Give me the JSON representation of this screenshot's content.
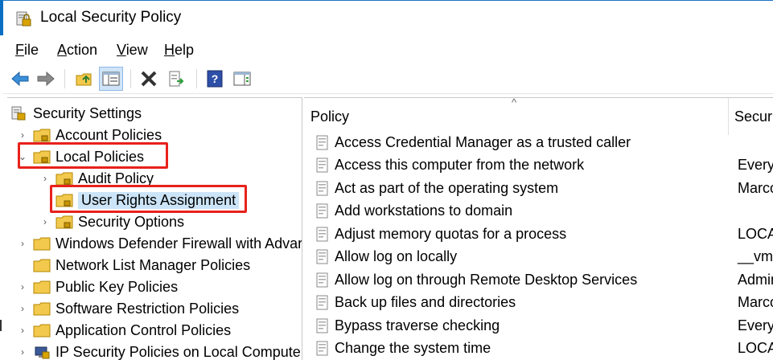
{
  "window": {
    "title": "Local Security Policy"
  },
  "menu": [
    "File",
    "Action",
    "View",
    "Help"
  ],
  "toolbar": {
    "buttons": [
      {
        "name": "back-button",
        "icon": "back-arrow-icon"
      },
      {
        "name": "forward-button",
        "icon": "forward-arrow-icon"
      },
      {
        "name": "up-one-level-button",
        "icon": "folder-up-icon"
      },
      {
        "name": "show-hide-console-tree-button",
        "icon": "console-tree-icon"
      },
      {
        "name": "delete-button",
        "icon": "delete-x-icon"
      },
      {
        "name": "export-list-button",
        "icon": "export-list-icon"
      },
      {
        "name": "help-button",
        "icon": "help-icon"
      },
      {
        "name": "show-hide-action-pane-button",
        "icon": "action-pane-icon"
      }
    ]
  },
  "tree": {
    "root": "Security Settings",
    "items": [
      {
        "label": "Account Policies"
      },
      {
        "label": "Local Policies"
      },
      {
        "label": "Audit Policy"
      },
      {
        "label": "User Rights Assignment"
      },
      {
        "label": "Security Options"
      },
      {
        "label": "Windows Defender Firewall with Advar"
      },
      {
        "label": "Network List Manager Policies"
      },
      {
        "label": "Public Key Policies"
      },
      {
        "label": "Software Restriction Policies"
      },
      {
        "label": "Application Control Policies"
      },
      {
        "label": "IP Security Policies on Local Computer"
      }
    ]
  },
  "list": {
    "columns": [
      "Policy",
      "Securit"
    ],
    "rows": [
      {
        "policy": "Access Credential Manager as a trusted caller",
        "setting": ""
      },
      {
        "policy": "Access this computer from the network",
        "setting": "Everyo"
      },
      {
        "policy": "Act as part of the operating system",
        "setting": "Marco"
      },
      {
        "policy": "Add workstations to domain",
        "setting": ""
      },
      {
        "policy": "Adjust memory quotas for a process",
        "setting": "LOCAL"
      },
      {
        "policy": "Allow log on locally",
        "setting": "__vmw"
      },
      {
        "policy": "Allow log on through Remote Desktop Services",
        "setting": "Admin"
      },
      {
        "policy": "Back up files and directories",
        "setting": "Marco"
      },
      {
        "policy": "Bypass traverse checking",
        "setting": "Everyo"
      },
      {
        "policy": "Change the system time",
        "setting": "LOCAL"
      }
    ]
  },
  "colors": {
    "accent": "#0a6fc2",
    "highlight_box": "#e8211b",
    "selection": "#cce4f7"
  }
}
